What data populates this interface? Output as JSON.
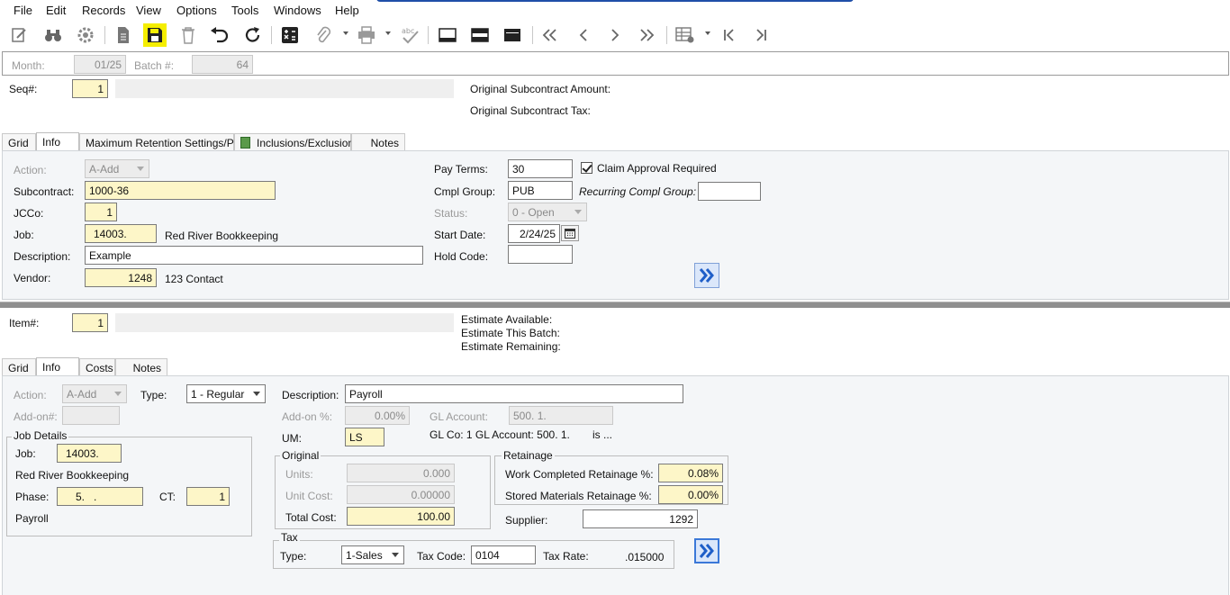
{
  "menu": [
    "File",
    "Edit",
    "Records",
    "View",
    "Options",
    "Tools",
    "Windows",
    "Help"
  ],
  "toolbar": {
    "icons": [
      "edit-doc-icon",
      "binoculars-icon",
      "settings-gear-icon",
      "new-document-icon",
      "save-icon",
      "delete-icon",
      "undo-icon",
      "refresh-icon",
      "calculator-icon",
      "attach-icon",
      "print-icon",
      "spellcheck-icon",
      "layout-single-icon",
      "layout-split-icon",
      "layout-full-icon",
      "first-page-icon",
      "prev-icon",
      "next-icon",
      "last-page-icon",
      "grid-options-icon",
      "first-record-icon",
      "last-record-icon"
    ],
    "highlight_color": "#f5ee00"
  },
  "header": {
    "month_label": "Month:",
    "month_value": "01/25",
    "batch_label": "Batch #:",
    "batch_value": "64"
  },
  "seq": {
    "label": "Seq#:",
    "value": "1",
    "orig_amount_label": "Original Subcontract Amount:",
    "orig_tax_label": "Original Subcontract Tax:"
  },
  "top_tabs": [
    "Grid",
    "Info",
    "Maximum Retention Settings/PBA",
    "Inclusions/Exclusions",
    "Notes"
  ],
  "top_info": {
    "action_label": "Action:",
    "action_value": "A-Add",
    "subcontract_label": "Subcontract:",
    "subcontract_value": "1000-36",
    "jcco_label": "JCCo:",
    "jcco_value": "1",
    "job_label": "Job:",
    "job_value": "14003.",
    "job_name": "Red River Bookkeeping",
    "description_label": "Description:",
    "description_value": "Example",
    "vendor_label": "Vendor:",
    "vendor_value": "1248",
    "vendor_name": "123 Contact",
    "pay_terms_label": "Pay Terms:",
    "pay_terms_value": "30",
    "claim_approval_label": "Claim Approval Required",
    "claim_approval_checked": true,
    "cmpl_group_label": "Cmpl Group:",
    "cmpl_group_value": "PUB",
    "recurring_label": "Recurring Compl Group:",
    "recurring_value": "",
    "status_label": "Status:",
    "status_value": "0 - Open",
    "start_date_label": "Start Date:",
    "start_date_value": "2/24/25",
    "hold_code_label": "Hold Code:",
    "hold_code_value": ""
  },
  "item": {
    "label": "Item#:",
    "value": "1",
    "est_available_label": "Estimate Available:",
    "est_batch_label": "Estimate This Batch:",
    "est_remaining_label": "Estimate Remaining:"
  },
  "bottom_tabs": [
    "Grid",
    "Info",
    "Costs",
    "Notes"
  ],
  "bottom_info": {
    "action_label": "Action:",
    "action_value": "A-Add",
    "type_label": "Type:",
    "type_value": "1 - Regular",
    "addon_label": "Add-on#:",
    "addon_value": "",
    "job_details_title": "Job Details",
    "job_label": "Job:",
    "job_value": "14003.",
    "job_name": "Red River Bookkeeping",
    "phase_label": "Phase:",
    "phase_value": "5.   .",
    "ct_label": "CT:",
    "ct_value": "1",
    "phase_name": "Payroll",
    "description_label": "Description:",
    "description_value": "Payroll",
    "addon_pct_label": "Add-on %:",
    "addon_pct_value": "0.00%",
    "gl_account_label": "GL Account:",
    "gl_account_value": "500. 1.",
    "um_label": "UM:",
    "um_value": "LS",
    "gl_info": "GL Co: 1 GL Account:  500. 1.",
    "gl_info_suffix": "is ...",
    "original_title": "Original",
    "units_label": "Units:",
    "units_value": "0.000",
    "unit_cost_label": "Unit Cost:",
    "unit_cost_value": "0.00000",
    "total_cost_label": "Total Cost:",
    "total_cost_value": "100.00",
    "retainage_title": "Retainage",
    "wc_ret_label": "Work Completed Retainage %:",
    "wc_ret_value": "0.08%",
    "sm_ret_label": "Stored Materials Retainage %:",
    "sm_ret_value": "0.00%",
    "supplier_label": "Supplier:",
    "supplier_value": "1292",
    "tax_title": "Tax",
    "tax_type_label": "Type:",
    "tax_type_value": "1-Sales",
    "tax_code_label": "Tax Code:",
    "tax_code_value": "0104",
    "tax_rate_label": "Tax Rate:",
    "tax_rate_value": ".015000"
  }
}
